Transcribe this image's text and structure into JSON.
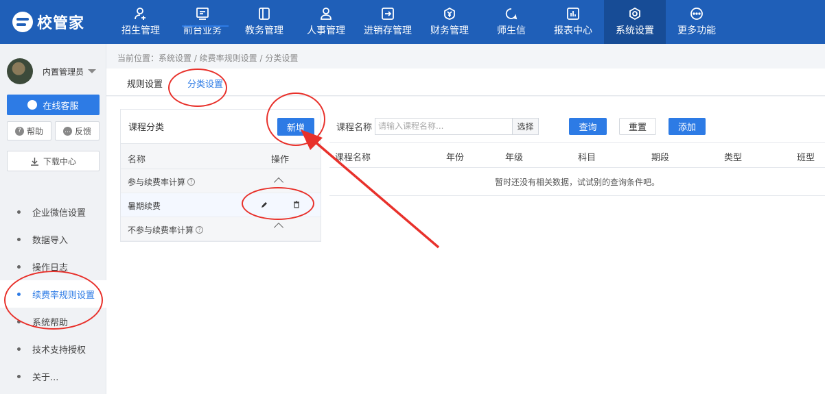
{
  "app": {
    "logo_text": "校管家"
  },
  "nav": {
    "items": [
      {
        "label": "招生管理",
        "icon": "user-plus-icon"
      },
      {
        "label": "前台业务",
        "icon": "monitor-icon"
      },
      {
        "label": "教务管理",
        "icon": "book-icon"
      },
      {
        "label": "人事管理",
        "icon": "person-icon"
      },
      {
        "label": "进销存管理",
        "icon": "inventory-icon"
      },
      {
        "label": "财务管理",
        "icon": "yen-shield-icon"
      },
      {
        "label": "师生信",
        "icon": "message-icon"
      },
      {
        "label": "报表中心",
        "icon": "chart-icon"
      },
      {
        "label": "系统设置",
        "icon": "gear-icon",
        "active": true
      },
      {
        "label": "更多功能",
        "icon": "more-icon"
      }
    ]
  },
  "sidebar": {
    "user_name": "内置管理员",
    "online_service": "在线客服",
    "help": "帮助",
    "feedback": "反馈",
    "download_center": "下载中心",
    "menu": [
      {
        "label": "企业微信设置"
      },
      {
        "label": "数据导入"
      },
      {
        "label": "操作日志"
      },
      {
        "label": "续费率规则设置",
        "active": true
      },
      {
        "label": "系统帮助"
      },
      {
        "label": "技术支持授权"
      },
      {
        "label": "关于..."
      }
    ]
  },
  "breadcrumb": "当前位置：系统设置 / 续费率规则设置 / 分类设置",
  "tabs": [
    {
      "label": "规则设置"
    },
    {
      "label": "分类设置",
      "active": true
    }
  ],
  "category_panel": {
    "title": "课程分类",
    "add_button": "新增",
    "col_name": "名称",
    "col_action": "操作",
    "rows": [
      {
        "label": "参与续费率计算",
        "type": "group",
        "help": "?"
      },
      {
        "label": "暑期续费",
        "type": "item"
      },
      {
        "label": "不参与续费率计算",
        "type": "group",
        "help": "?"
      }
    ]
  },
  "filter": {
    "course_label": "课程名称",
    "course_placeholder": "请输入课程名称...",
    "choose": "选择",
    "query": "查询",
    "reset": "重置",
    "add": "添加"
  },
  "table": {
    "columns": [
      "课程名称",
      "年份",
      "年级",
      "科目",
      "期段",
      "类型",
      "班型"
    ],
    "empty_text": "暂时还没有相关数据，试试别的查询条件吧。"
  },
  "colors": {
    "primary": "#2d7be5",
    "nav_bg": "#1f5fb8",
    "annotation": "#e8312b"
  }
}
